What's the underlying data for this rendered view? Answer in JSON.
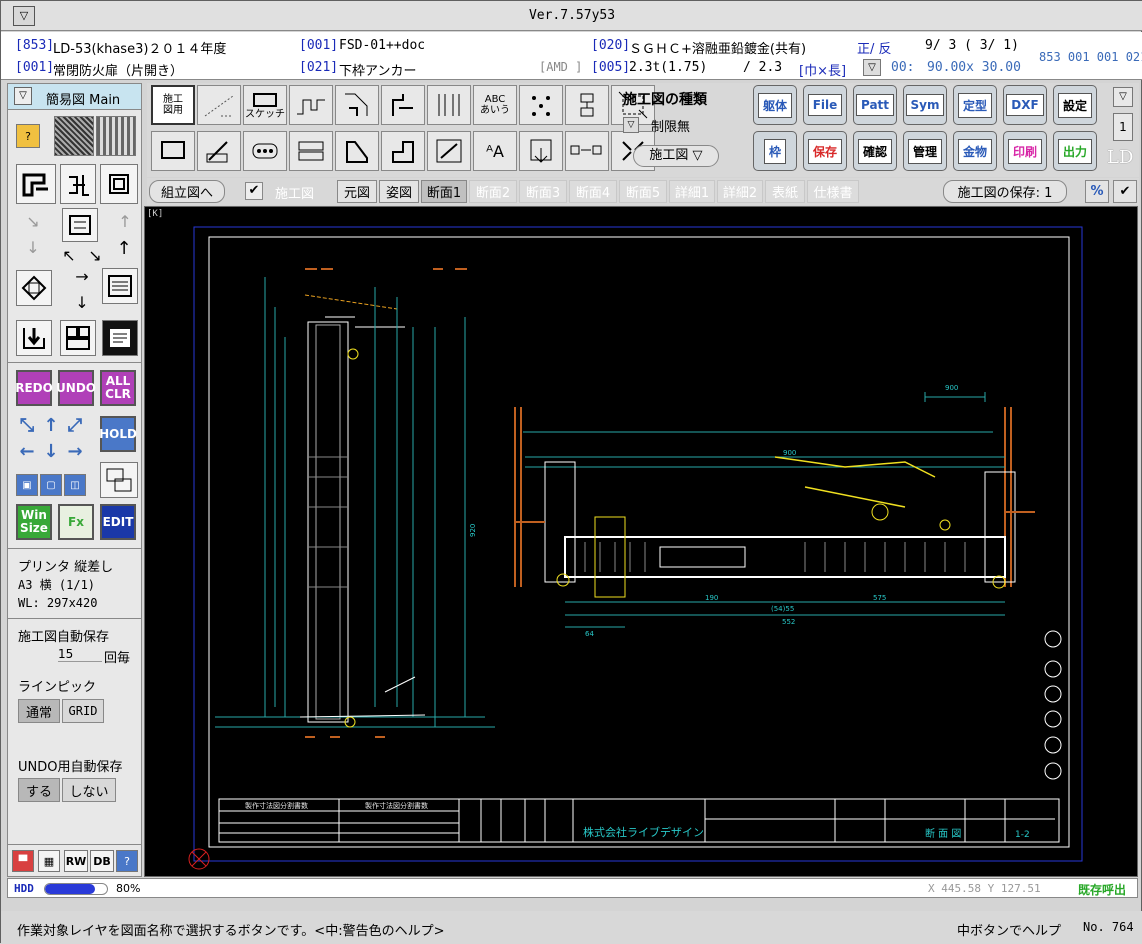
{
  "app": {
    "version": "Ver.7.57y53"
  },
  "info": {
    "row1": {
      "code1": "[853]",
      "file": "LD-53(khase3)２０１４年度",
      "code2": "[001]",
      "doc": "FSD-01++doc",
      "code3": "[020]",
      "material": "ＳＧＨＣ+溶融亜鉛鍍金(共有)",
      "side": "正/ 反",
      "page": "9/  3 (  3/  1)",
      "ids": "853 001 001 021"
    },
    "row2": {
      "code1": "[001]",
      "name": "常閉防火扉（片開き）",
      "code2": "[021]",
      "part": "下枠アンカー",
      "amd": "[AMD ]",
      "code3": "[005]",
      "thickness": "2.3t(1.75)",
      "thick2": "/ 2.3",
      "dims_label": "[巾×長]",
      "xy_label": "00:",
      "dims": "90.00x 30.00"
    }
  },
  "left": {
    "mode_label": "簡易図 Main",
    "tool_letters": [
      "A",
      "B",
      "H",
      "C",
      "G",
      "I",
      "D",
      "F",
      "J",
      "E",
      "K"
    ],
    "redo": "REDO",
    "undo": "UNDO",
    "allclr": "ALL\nCLR",
    "hold": "HOLD",
    "winsize": "Win\nSize",
    "edit": "EDIT",
    "printer_title": "プリンタ 縦差し",
    "printer_size": "A3 横 (1/1)",
    "printer_wl": "WL: 297x420",
    "autosave_title": "施工図自動保存",
    "autosave_value": "15",
    "autosave_unit": "回毎",
    "linepick_title": "ラインピック",
    "linepick_opts": [
      "通常",
      "GRID"
    ],
    "undosave_title": "UNDO用自動保存",
    "undosave_opts": [
      "する",
      "しない"
    ],
    "bottom_icons": [
      "RW",
      "DB"
    ]
  },
  "toolbar": {
    "small_row1": [
      "施工\n図用",
      "",
      "スケッチ",
      "",
      "",
      "",
      "",
      "ABC\nあいう",
      "",
      "",
      ""
    ],
    "panel_title": "施工図の種類",
    "panel_limit": "制限無",
    "panel_select": "施工図 ▽",
    "big_row1": [
      "躯体",
      "File",
      "Patt",
      "Sym",
      "定型",
      "DXF",
      "設定"
    ],
    "big_row2": [
      "枠",
      "保存",
      "確認",
      "管理",
      "金物",
      "印刷",
      "出力"
    ],
    "right_num": "1",
    "right_ld": "LD"
  },
  "tabs": {
    "assembly": "組立図へ",
    "sekou": "施工図",
    "list": [
      "元図",
      "姿図",
      "断面1",
      "断面2",
      "断面3",
      "断面4",
      "断面5",
      "詳細1",
      "詳細2",
      "表紙",
      "仕様書"
    ],
    "save": "施工図の保存: 1",
    "percent": "%",
    "check": "✔"
  },
  "canvas": {
    "corner": "[K]",
    "titleblock": {
      "hdr1": "製作寸法図分割書数",
      "hdr2": "製作寸法図分割書数",
      "company": "株式会社ライブデザイン",
      "drawing": "断 面 図",
      "sheet": "1-2"
    },
    "dims": [
      "900",
      "900",
      "190",
      "(54)55",
      "575",
      "552",
      "64",
      "920"
    ]
  },
  "status": {
    "hdd": "HDD",
    "hdd_pct": "80%",
    "hdd_fill": 0.8,
    "coords": "X    445.58 Y   127.51",
    "existing": "既存呼出",
    "help": "作業対象レイヤを図面名称で選択するボタンです。<中:警告色のヘルプ>",
    "middle_help": "中ボタンでヘルプ",
    "number": "No. 764"
  }
}
